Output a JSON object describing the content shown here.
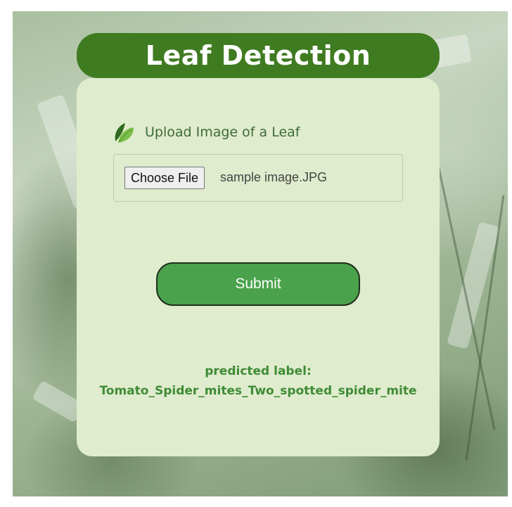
{
  "header": {
    "title": "Leaf Detection"
  },
  "upload": {
    "label": "Upload Image of a Leaf",
    "icon": "leaf-icon",
    "choose_button_label": "Choose File",
    "file_name": "sample image.JPG"
  },
  "form": {
    "submit_label": "Submit"
  },
  "result": {
    "heading": "predicted label:",
    "value": "Tomato_Spider_mites_Two_spotted_spider_mite"
  },
  "colors": {
    "title_bar": "#3f7b20",
    "card": "#dfeccd",
    "submit": "#4aa24c",
    "result_text": "#3f8b36",
    "label_text": "#3f6a3a"
  }
}
